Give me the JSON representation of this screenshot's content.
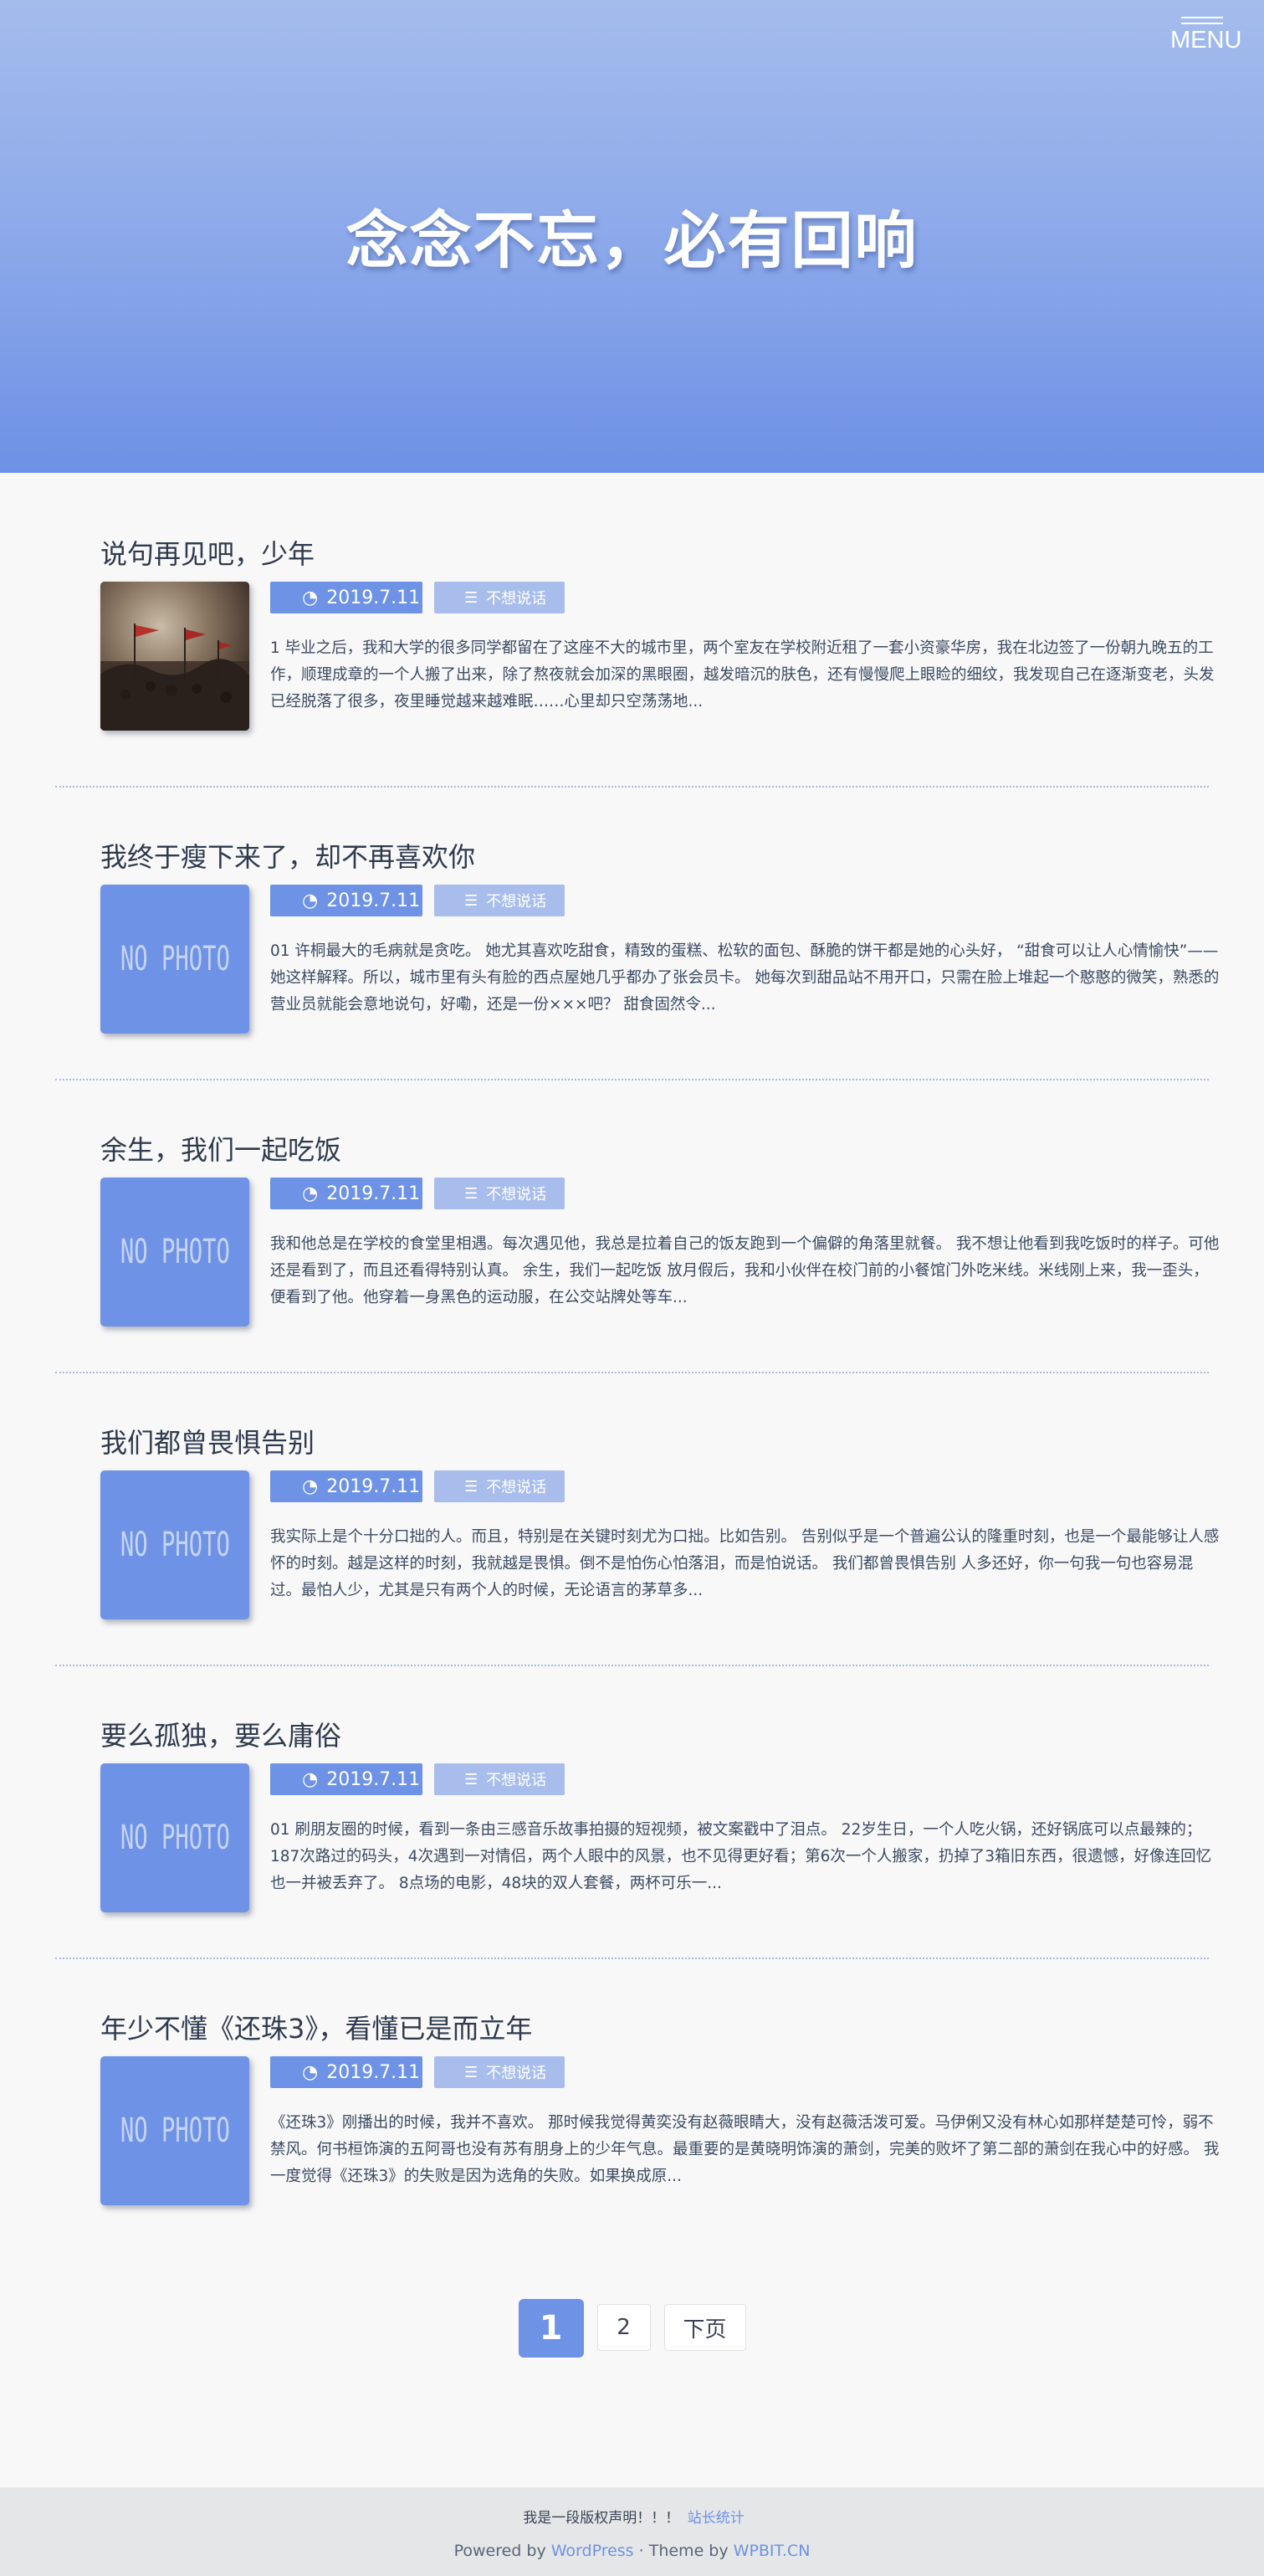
{
  "header": {
    "menu_label": "MENU",
    "title": "念念不忘，必有回响"
  },
  "colors": {
    "accent": "#6e92e6",
    "accent_light": "#a8bdec",
    "hero_top": "#a4bcec",
    "hero_bottom": "#6e91e6"
  },
  "posts": [
    {
      "title": "说句再见吧，少年",
      "date": "2019.7.11",
      "category": "不想说话",
      "thumbnail": "image",
      "excerpt": "1 毕业之后，我和大学的很多同学都留在了这座不大的城市里，两个室友在学校附近租了一套小资豪华房，我在北边签了一份朝九晚五的工作，顺理成章的一个人搬了出来，除了熬夜就会加深的黑眼圈，越发暗沉的肤色，还有慢慢爬上眼睑的细纹，我发现自己在逐渐变老，头发已经脱落了很多，夜里睡觉越来越难眠……心里却只空荡荡地..."
    },
    {
      "title": "我终于瘦下来了，却不再喜欢你",
      "date": "2019.7.11",
      "category": "不想说话",
      "thumbnail": "NO PHOTO",
      "excerpt": "01 许桐最大的毛病就是贪吃。 她尤其喜欢吃甜食，精致的蛋糕、松软的面包、酥脆的饼干都是她的心头好， “甜食可以让人心情愉快”——她这样解释。所以，城市里有头有脸的西点屋她几乎都办了张会员卡。 她每次到甜品站不用开口，只需在脸上堆起一个憨憨的微笑，熟悉的营业员就能会意地说句，好嘞，还是一份×××吧？ 甜食固然令..."
    },
    {
      "title": "余生，我们一起吃饭",
      "date": "2019.7.11",
      "category": "不想说话",
      "thumbnail": "NO PHOTO",
      "excerpt": "我和他总是在学校的食堂里相遇。每次遇见他，我总是拉着自己的饭友跑到一个偏僻的角落里就餐。 我不想让他看到我吃饭时的样子。可他还是看到了，而且还看得特别认真。 余生，我们一起吃饭 放月假后，我和小伙伴在校门前的小餐馆门外吃米线。米线刚上来，我一歪头，便看到了他。他穿着一身黑色的运动服，在公交站牌处等车..."
    },
    {
      "title": "我们都曾畏惧告别",
      "date": "2019.7.11",
      "category": "不想说话",
      "thumbnail": "NO PHOTO",
      "excerpt": "我实际上是个十分口拙的人。而且，特别是在关键时刻尤为口拙。比如告别。 告别似乎是一个普遍公认的隆重时刻，也是一个最能够让人感怀的时刻。越是这样的时刻，我就越是畏惧。倒不是怕伤心怕落泪，而是怕说话。 我们都曾畏惧告别 人多还好，你一句我一句也容易混过。最怕人少，尤其是只有两个人的时候，无论语言的茅草多..."
    },
    {
      "title": "要么孤独，要么庸俗",
      "date": "2019.7.11",
      "category": "不想说话",
      "thumbnail": "NO PHOTO",
      "excerpt": "01 刷朋友圈的时候，看到一条由三感音乐故事拍摄的短视频，被文案戳中了泪点。 22岁生日，一个人吃火锅，还好锅底可以点最辣的；187次路过的码头，4次遇到一对情侣，两个人眼中的风景，也不见得更好看；第6次一个人搬家，扔掉了3箱旧东西，很遗憾，好像连回忆也一并被丢弃了。 8点场的电影，48块的双人套餐，两杯可乐一..."
    },
    {
      "title": "年少不懂《还珠3》，看懂已是而立年",
      "date": "2019.7.11",
      "category": "不想说话",
      "thumbnail": "NO PHOTO",
      "excerpt": "《还珠3》刚播出的时候，我并不喜欢。 那时候我觉得黄奕没有赵薇眼睛大，没有赵薇活泼可爱。马伊俐又没有林心如那样楚楚可怜，弱不禁风。何书桓饰演的五阿哥也没有苏有朋身上的少年气息。最重要的是黄晓明饰演的萧剑，完美的败坏了第二部的萧剑在我心中的好感。 我一度觉得《还珠3》的失败是因为选角的失败。如果换成原..."
    }
  ],
  "pagination": {
    "current": "1",
    "page2": "2",
    "next": "下页"
  },
  "footer": {
    "copyright": "我是一段版权声明！！！",
    "stats": "站长统计",
    "powered_by": "Powered by",
    "wordpress": "WordPress",
    "separator": "·",
    "theme_by": "Theme by",
    "theme_link": "WPBIT.CN"
  }
}
